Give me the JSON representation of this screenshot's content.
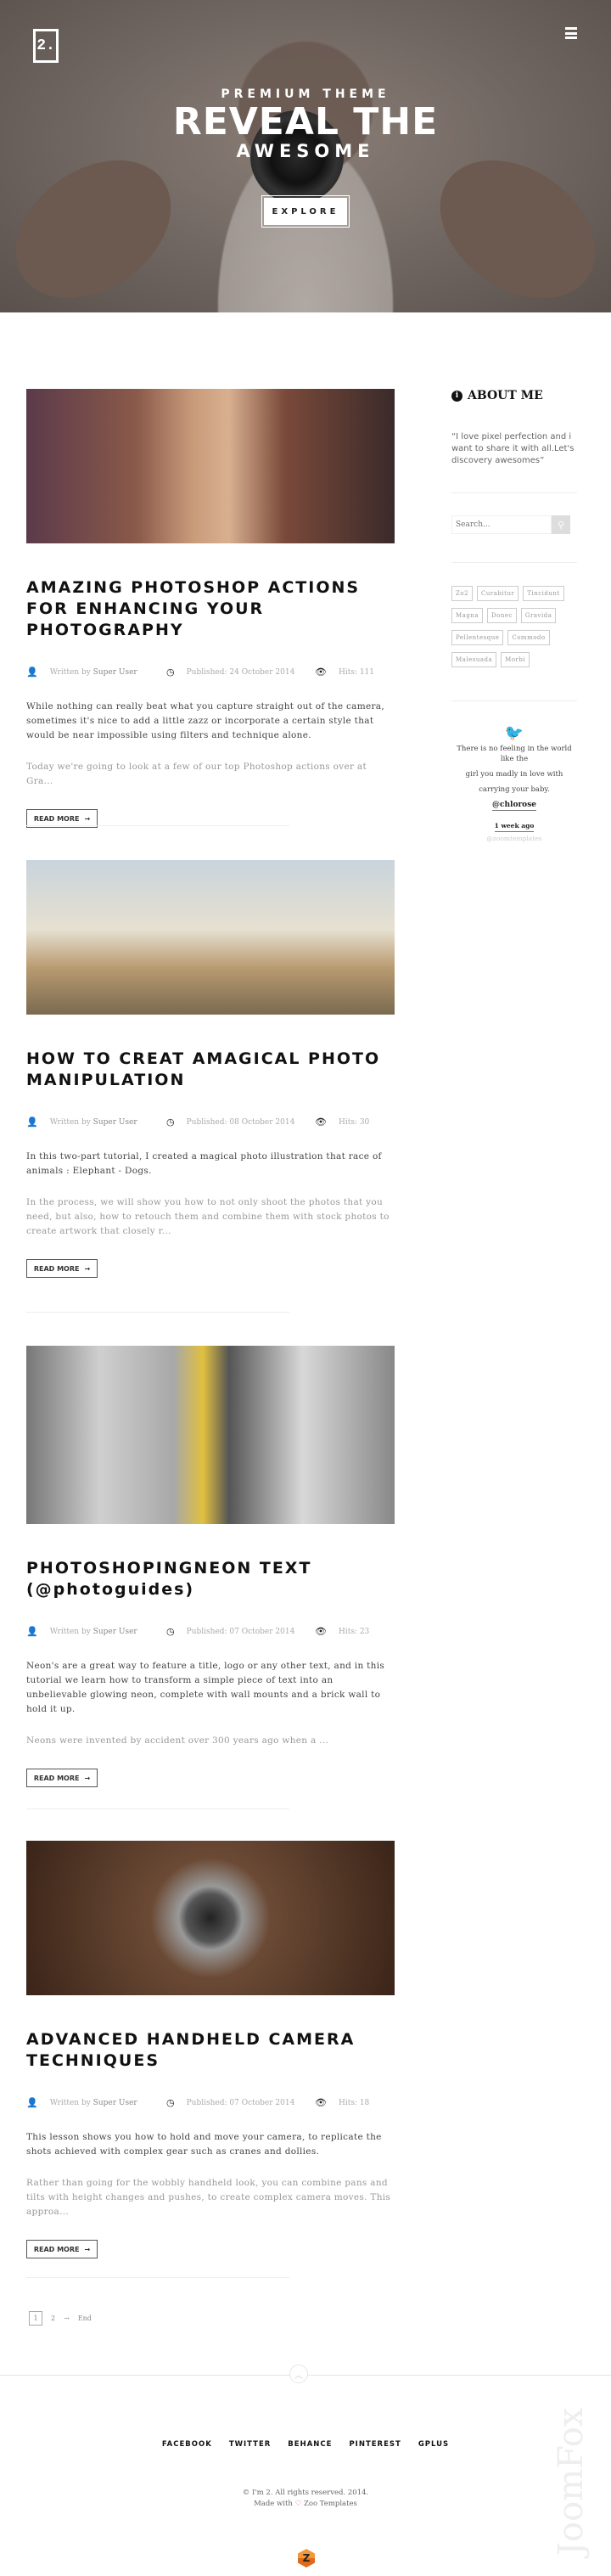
{
  "header": {
    "logo_text": "2.",
    "menu_icon": "hamburger-icon"
  },
  "hero": {
    "kicker": "PREMIUM THEME",
    "title": "REVEAL THE",
    "subtitle": "AWESOME",
    "button": "EXPLORE"
  },
  "posts": [
    {
      "title": "AMAZING PHOTOSHOP ACTIONS FOR ENHANCING YOUR PHOTOGRAPHY",
      "written_by": "Written by",
      "author": "Super User",
      "published": "Published: 24 October 2014",
      "hits": "Hits: 111",
      "intro": "While nothing can really beat what you capture straight out of the camera, sometimes it's nice to add a little zazz or incorporate a certain style that would be near impossible using filters and technique alone.",
      "more": "Today we're going to look at a few of our top Photoshop actions over at Gra...",
      "read_more": "READ MORE"
    },
    {
      "title": "HOW TO CREAT AMAGICAL PHOTO MANIPULATION",
      "written_by": "Written by",
      "author": "Super User",
      "published": "Published: 08 October 2014",
      "hits": "Hits: 30",
      "intro": "In this two-part tutorial, I created a magical photo illustration that race of animals : Elephant - Dogs.",
      "more": "In the process, we will show you how to not only shoot the photos that you need, but also, how to retouch them and combine them with stock photos to create artwork that closely r...",
      "read_more": "READ MORE"
    },
    {
      "title": "PHOTOSHOPINGNEON TEXT (@photoguides)",
      "written_by": "Written by",
      "author": "Super User",
      "published": "Published: 07 October 2014",
      "hits": "Hits: 23",
      "intro": "Neon's are a great way to feature a title, logo or any other text, and in this tutorial we learn how to transform a simple piece of text into an unbelievable glowing neon, complete with wall mounts and a brick wall to hold it up.",
      "more": "Neons were invented by accident over 300 years ago when a ...",
      "read_more": "READ MORE"
    },
    {
      "title": "ADVANCED HANDHELD CAMERA TECHNIQUES",
      "written_by": "Written by",
      "author": "Super User",
      "published": "Published: 07 October 2014",
      "hits": "Hits: 18",
      "intro": "This lesson shows you how to hold and move your camera, to replicate the shots achieved with complex gear such as cranes and dollies.",
      "more": "Rather than going for the wobbly handheld look, you can combine pans and tilts with height changes and pushes, to create complex camera moves. This approa...",
      "read_more": "READ MORE"
    }
  ],
  "sidebar": {
    "about_title": "ABOUT ME",
    "about_quote": "“I love pixel perfection and i want to share it with all.Let's discovery awesomes”",
    "search_placeholder": "Search...",
    "tags": [
      "Zo2",
      "Curabitur",
      "Tincidunt",
      "Magna",
      "Donec",
      "Gravida",
      "Pellentesque",
      "Commodo",
      "Malesuada",
      "Morbi"
    ],
    "tweet": {
      "line1": "There is no feeling in the world like the",
      "line2": "girl you madly in love with",
      "line3": "carrying your baby.",
      "mention": "@chlorose",
      "time": "1 week ago",
      "user": "@zoomtemplates"
    }
  },
  "pagination": {
    "current": "1",
    "next_page": "2",
    "end": "End"
  },
  "footer": {
    "social": [
      "FACEBOOK",
      "TWITTER",
      "BEHANCE",
      "PINTEREST",
      "GPLUS"
    ],
    "copyright": "© I'm 2. All rights reserved. 2014.",
    "made_with": "Made with",
    "made_by": "Zoo Templates",
    "watermark": "JoomFox"
  },
  "colors": {
    "accent_twitter": "#3ab5ee",
    "heart": "#ee5555"
  }
}
